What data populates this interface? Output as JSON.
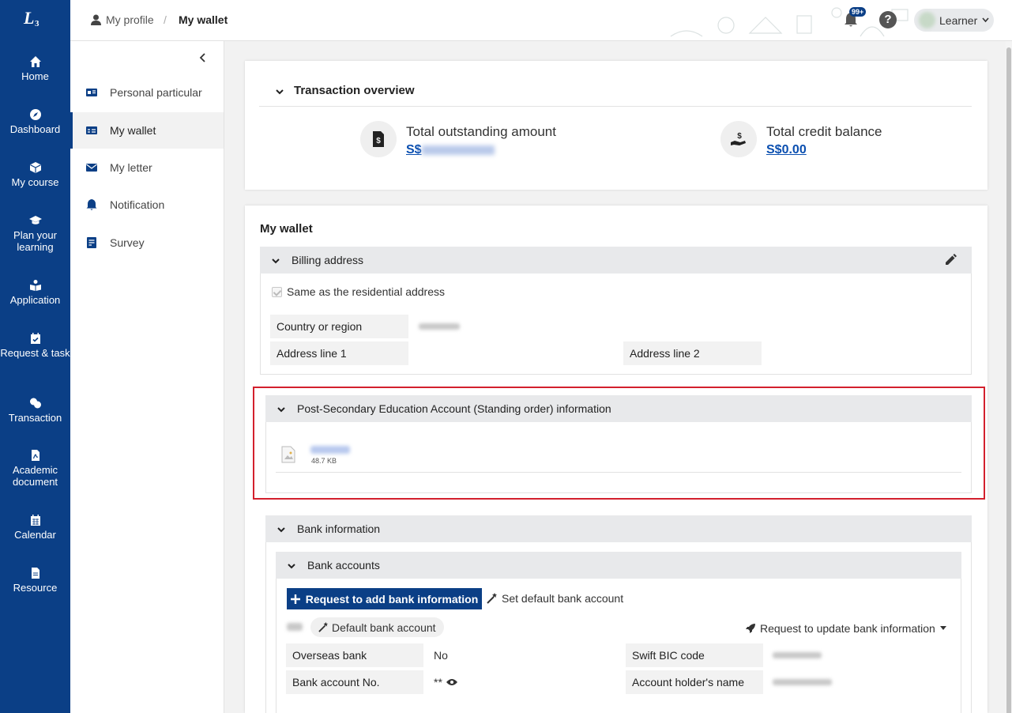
{
  "nav": {
    "logo": "L",
    "logo_sup": "3",
    "items": [
      {
        "label": "Home",
        "icon": "home-icon"
      },
      {
        "label": "Dashboard",
        "icon": "compass-icon"
      },
      {
        "label": "My course",
        "icon": "cube-icon"
      },
      {
        "label": "Plan your learning",
        "icon": "graduation-cap-icon"
      },
      {
        "label": "Application",
        "icon": "book-reader-icon"
      },
      {
        "label": "Request & task",
        "icon": "calendar-check-icon"
      },
      {
        "label": "Transaction",
        "icon": "money-exchange-icon"
      },
      {
        "label": "Academic document",
        "icon": "pdf-file-icon"
      },
      {
        "label": "Calendar",
        "icon": "calendar-icon"
      },
      {
        "label": "Resource",
        "icon": "file-icon"
      }
    ]
  },
  "topbar": {
    "breadcrumb_profile": "My profile",
    "breadcrumb_sep": "/",
    "breadcrumb_current": "My wallet",
    "notification_badge": "99+",
    "help_label": "?",
    "user_name": "Learner"
  },
  "subnav": {
    "items": [
      {
        "label": "Personal particular",
        "icon": "id-card-icon"
      },
      {
        "label": "My wallet",
        "icon": "wallet-card-icon"
      },
      {
        "label": "My letter",
        "icon": "envelope-icon"
      },
      {
        "label": "Notification",
        "icon": "bell-icon"
      },
      {
        "label": "Survey",
        "icon": "survey-icon"
      }
    ]
  },
  "overview": {
    "title": "Transaction overview",
    "outstanding_label": "Total outstanding amount",
    "outstanding_currency": "S$",
    "credit_label": "Total credit balance",
    "credit_value": "S$0.00"
  },
  "wallet": {
    "title": "My wallet",
    "billing": {
      "title": "Billing address",
      "same_as_residential": "Same as the residential address",
      "country_label": "Country or region",
      "address1_label": "Address line 1",
      "address2_label": "Address line 2"
    },
    "pse": {
      "title": "Post-Secondary Education Account (Standing order) information",
      "file_size": "48.7 KB"
    },
    "bank": {
      "title": "Bank information",
      "accounts_title": "Bank accounts",
      "add_button": "Request to add bank information",
      "set_default": "Set default bank account",
      "default_badge": "Default bank account",
      "update_request": "Request to update bank information",
      "overseas_label": "Overseas bank",
      "overseas_value": "No",
      "swift_label": "Swift BIC code",
      "account_no_label": "Bank account No.",
      "account_no_value": "**",
      "holder_label": "Account holder's name"
    }
  }
}
